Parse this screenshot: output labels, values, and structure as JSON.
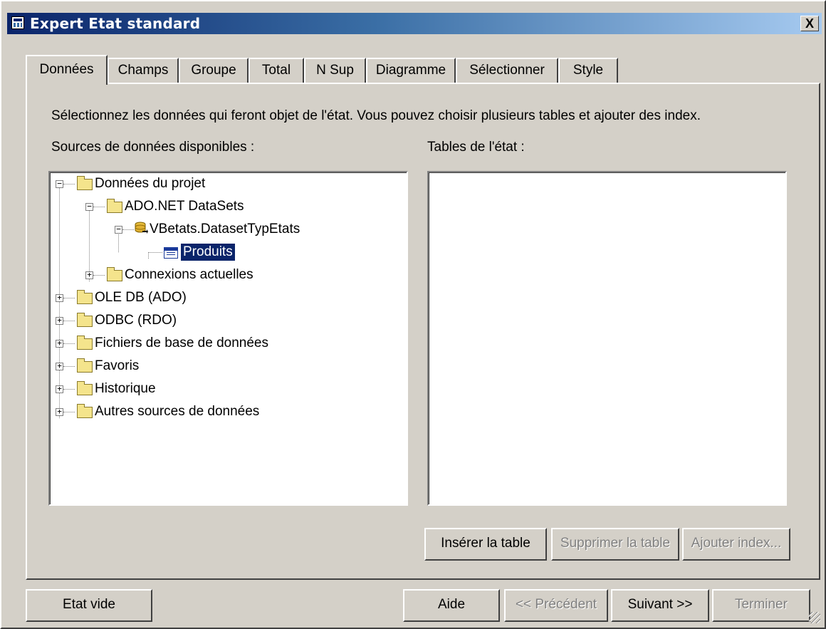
{
  "window": {
    "title": "Expert Etat standard",
    "close_label": "X"
  },
  "tabs": [
    {
      "label": "Données",
      "active": true
    },
    {
      "label": "Champs"
    },
    {
      "label": "Groupe"
    },
    {
      "label": "Total"
    },
    {
      "label": "N Sup"
    },
    {
      "label": "Diagramme"
    },
    {
      "label": "Sélectionner"
    },
    {
      "label": "Style"
    }
  ],
  "panel": {
    "instructions": "Sélectionnez les données qui feront objet de l'état. Vous pouvez choisir plusieurs tables et ajouter des index.",
    "sources_label": "Sources de données disponibles :",
    "tables_label": "Tables de l'état :"
  },
  "tree": [
    {
      "label": "Données du projet",
      "icon": "folder-icon",
      "expander": "−"
    },
    {
      "label": "ADO.NET DataSets",
      "icon": "folder-icon",
      "expander": "−"
    },
    {
      "label": "VBetats.DatasetTypEtats",
      "icon": "database-icon",
      "expander": "−"
    },
    {
      "label": "Produits",
      "icon": "table-icon",
      "selected": true
    },
    {
      "label": "Connexions actuelles",
      "icon": "folder-icon",
      "expander": "+"
    },
    {
      "label": "OLE DB (ADO)",
      "icon": "folder-icon",
      "expander": "+"
    },
    {
      "label": "ODBC (RDO)",
      "icon": "folder-icon",
      "expander": "+"
    },
    {
      "label": "Fichiers de base de données",
      "icon": "folder-icon",
      "expander": "+"
    },
    {
      "label": "Favoris",
      "icon": "folder-icon",
      "expander": "+"
    },
    {
      "label": "Historique",
      "icon": "folder-icon",
      "expander": "+"
    },
    {
      "label": "Autres sources de données",
      "icon": "folder-icon",
      "expander": "+"
    }
  ],
  "table_buttons": {
    "insert": "Insérer la table",
    "delete": "Supprimer la table",
    "add_index": "Ajouter index..."
  },
  "footer": {
    "empty_report": "Etat vide",
    "help": "Aide",
    "previous": "<< Précédent",
    "next": "Suivant >>",
    "finish": "Terminer"
  },
  "colors": {
    "window_bg": "#d4d0c8",
    "title_gradient_start": "#0a246a",
    "selection": "#0a246a"
  }
}
